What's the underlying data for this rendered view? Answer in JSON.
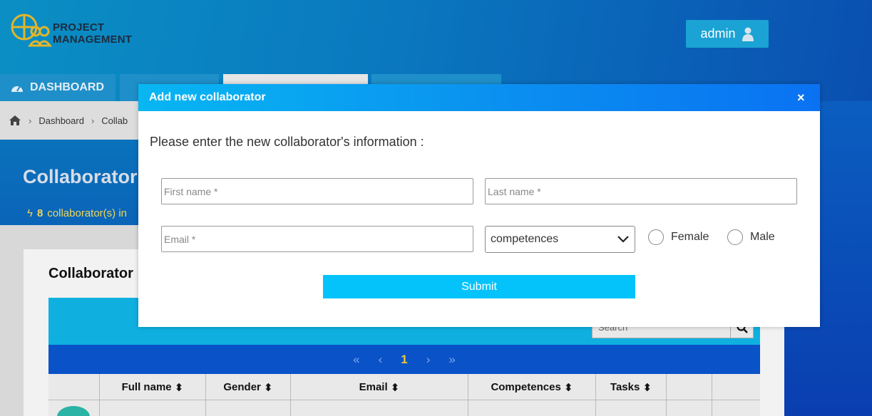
{
  "app": {
    "logo_text_line1": "PROJECT",
    "logo_text_line2": "MANAGEMENT",
    "user_label": "admin"
  },
  "nav": {
    "tabs": [
      {
        "label": "DASHBOARD",
        "icon": "dashboard-icon"
      }
    ]
  },
  "breadcrumb": {
    "items": [
      "Dashboard",
      "Collab"
    ]
  },
  "page": {
    "title": "Collaborator",
    "count": "8",
    "count_text": "collaborator(s) in",
    "card_title": "Collaborator"
  },
  "table": {
    "search_placeholder": "Search",
    "pager": {
      "first": "«",
      "prev": "‹",
      "current": "1",
      "next": "›",
      "last": "»"
    },
    "columns": [
      "",
      "Full name",
      "Gender",
      "Email",
      "Competences",
      "Tasks",
      "",
      ""
    ]
  },
  "modal": {
    "title": "Add new collaborator",
    "close_label": "×",
    "intro": "Please enter the new collaborator's information :",
    "first_name_placeholder": "First name *",
    "last_name_placeholder": "Last name *",
    "email_placeholder": "Email *",
    "competences_selected": "competences",
    "gender_options": [
      "Female",
      "Male"
    ],
    "submit_label": "Submit"
  },
  "colors": {
    "accent": "#04c3fb",
    "header_blue": "#0a78bf",
    "pager_blue": "#0a52c8",
    "highlight_yellow": "#f1d55a"
  }
}
